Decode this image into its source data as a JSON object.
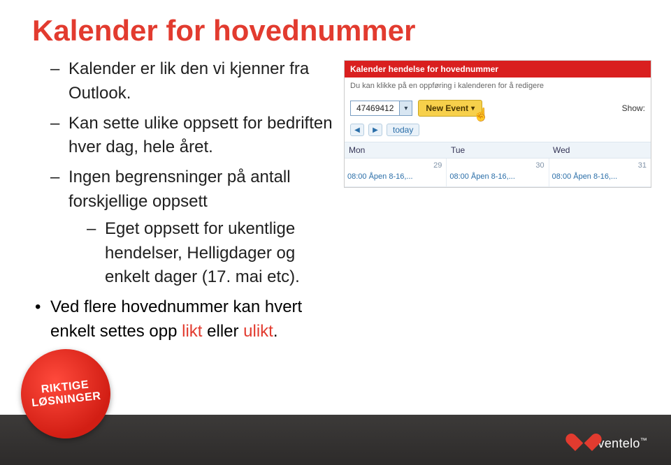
{
  "title": "Kalender for hovednummer",
  "bullets": {
    "b1": "Kalender er lik den vi kjenner fra Outlook.",
    "b2": "Kan sette ulike oppsett for bedriften hver dag, hele året.",
    "b3": "Ingen begrensninger på antall forskjellige oppsett",
    "b3_sub": "Eget oppsett for ukentlige hendelser, Helligdager og enkelt dager (17. mai etc)."
  },
  "dot_line_pre": "Ved flere hovednummer kan hvert enkelt settes opp ",
  "likt": "likt",
  "eller": " eller ",
  "ulikt": "ulikt",
  "period": ".",
  "shot": {
    "header": "Kalender hendelse for hovednummer",
    "sub": "Du kan klikke på en oppføring i kalenderen for å redigere",
    "number": "47469412",
    "new_event": "New Event",
    "show": "Show:",
    "today": "today",
    "days": {
      "mon": "Mon",
      "tue": "Tue",
      "wed": "Wed"
    },
    "nums": {
      "mon": "29",
      "tue": "30",
      "wed": "31"
    },
    "event": "08:00 Åpen 8-16,..."
  },
  "badge": {
    "l1": "RIKTIGE",
    "l2": "LØSNINGER"
  },
  "brand": "ventelo",
  "tm": "™"
}
